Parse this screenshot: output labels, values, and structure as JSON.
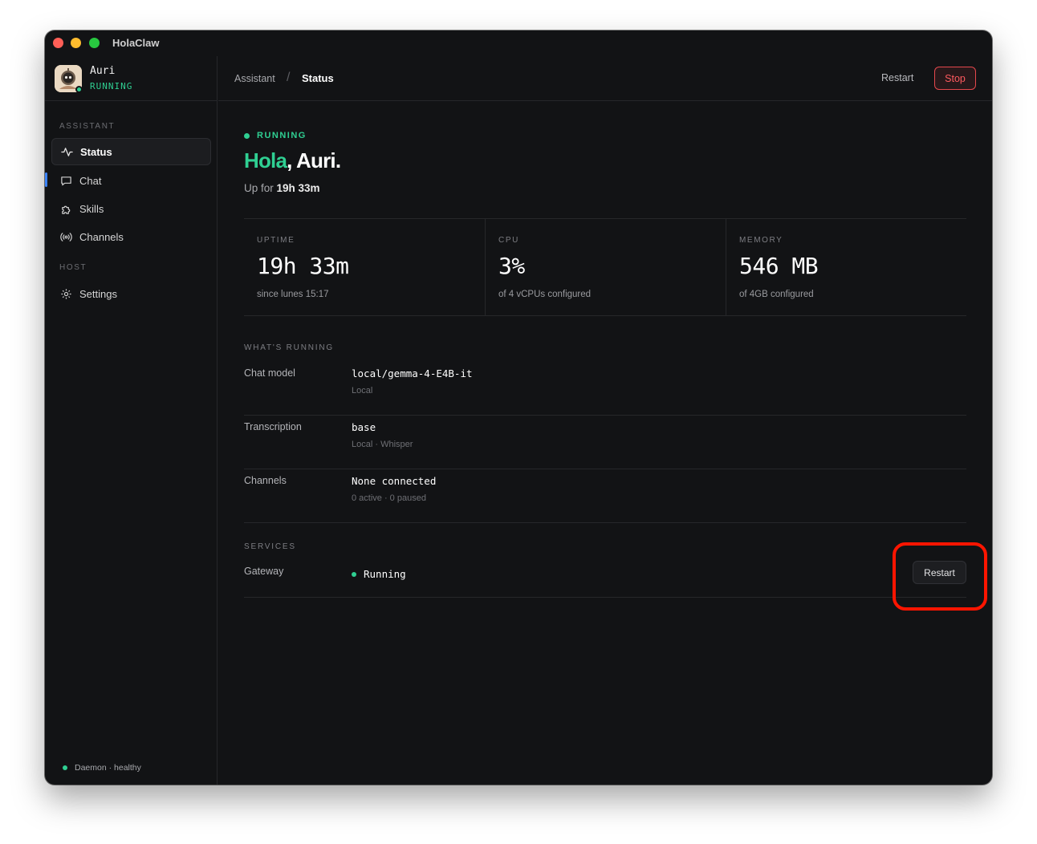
{
  "app": {
    "title": "HolaClaw"
  },
  "profile": {
    "name": "Auri",
    "status": "RUNNING"
  },
  "sidebar": {
    "sections": [
      {
        "label": "ASSISTANT"
      },
      {
        "label": "HOST"
      }
    ],
    "items": [
      {
        "label": "Status",
        "icon": "activity-icon",
        "active": true
      },
      {
        "label": "Chat",
        "icon": "chat-bubble-icon"
      },
      {
        "label": "Skills",
        "icon": "puzzle-icon"
      },
      {
        "label": "Channels",
        "icon": "broadcast-icon"
      },
      {
        "label": "Settings",
        "icon": "gear-icon"
      }
    ],
    "footer": "Daemon · healthy"
  },
  "header": {
    "breadcrumb": [
      "Assistant",
      "Status"
    ],
    "separator": "/",
    "restart_label": "Restart",
    "stop_label": "Stop"
  },
  "hero": {
    "status": "RUNNING",
    "greeting": "Hola",
    "name": ", Auri.",
    "uptime_prefix": "Up for",
    "uptime_value": "19h 33m"
  },
  "stats": [
    {
      "label": "UPTIME",
      "value": "19h 33m",
      "sub": "since lunes 15:17"
    },
    {
      "label": "CPU",
      "value": "3%",
      "sub": "of 4 vCPUs configured"
    },
    {
      "label": "MEMORY",
      "value": "546 MB",
      "sub": "of 4GB configured"
    }
  ],
  "whats_running": {
    "label": "WHAT'S RUNNING",
    "rows": [
      {
        "key": "Chat model",
        "value": "local/gemma-4-E4B-it",
        "sub": "Local"
      },
      {
        "key": "Transcription",
        "value": "base",
        "sub": "Local · Whisper"
      },
      {
        "key": "Channels",
        "value": "None connected",
        "sub": "0 active · 0 paused"
      }
    ]
  },
  "services": {
    "label": "SERVICES",
    "rows": [
      {
        "key": "Gateway",
        "status": "Running",
        "action_label": "Restart"
      }
    ]
  },
  "colors": {
    "accent_green": "#2fcf92",
    "stop_red": "#e5484d",
    "nav_accent": "#3b82f6",
    "highlight": "#ff1500",
    "background": "#121315"
  }
}
